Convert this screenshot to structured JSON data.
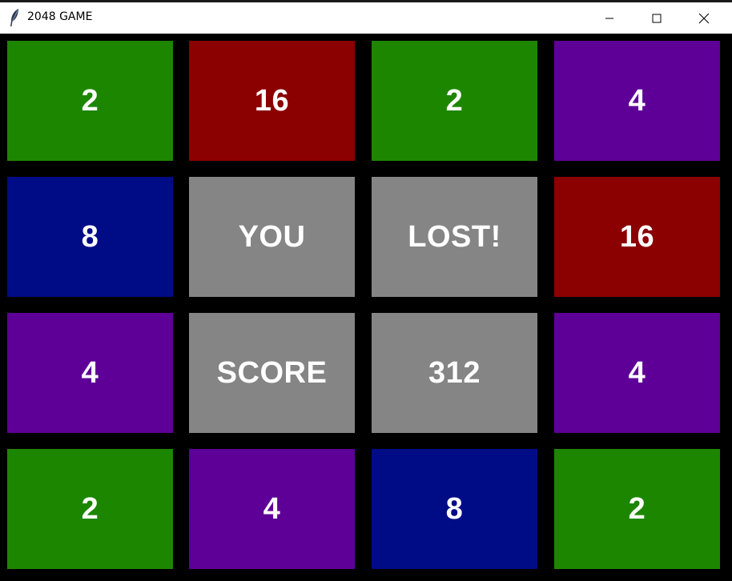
{
  "window": {
    "title": "2048 GAME",
    "icon": "feather-icon",
    "controls": [
      "minimize-icon",
      "maximize-icon",
      "close-icon"
    ]
  },
  "colors": {
    "2": "#1d8600",
    "4": "#5e0097",
    "8": "#000c86",
    "16": "#8b0000",
    "message": "#858585",
    "background": "#000000",
    "text": "#ffffff"
  },
  "board": {
    "rows": [
      [
        "2",
        "16",
        "2",
        "4"
      ],
      [
        "8",
        "YOU",
        "LOST!",
        "16"
      ],
      [
        "4",
        "SCORE",
        "312",
        "4"
      ],
      [
        "2",
        "4",
        "8",
        "2"
      ]
    ]
  },
  "game_over": {
    "line1": "YOU",
    "line2": "LOST!",
    "score_label": "SCORE",
    "score_value": "312"
  }
}
